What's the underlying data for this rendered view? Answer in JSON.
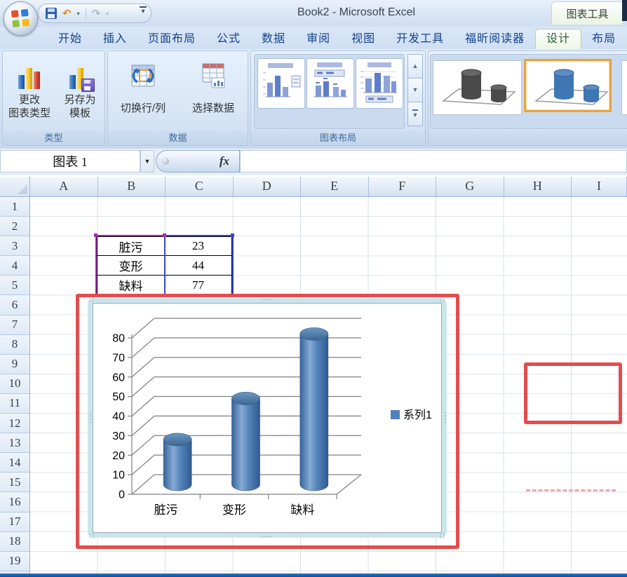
{
  "window": {
    "title": "Book2 - Microsoft Excel",
    "contextual_tool_label": "图表工具"
  },
  "tabs": {
    "items": [
      {
        "label": "开始",
        "active": false
      },
      {
        "label": "插入",
        "active": false
      },
      {
        "label": "页面布局",
        "active": false
      },
      {
        "label": "公式",
        "active": false
      },
      {
        "label": "数据",
        "active": false
      },
      {
        "label": "审阅",
        "active": false
      },
      {
        "label": "视图",
        "active": false
      },
      {
        "label": "开发工具",
        "active": false
      },
      {
        "label": "福昕阅读器",
        "active": false
      },
      {
        "label": "设计",
        "active": true
      },
      {
        "label": "布局",
        "active": false
      }
    ]
  },
  "ribbon": {
    "type_group": {
      "label": "类型",
      "change_chart_type": {
        "line1": "更改",
        "line2": "图表类型"
      },
      "save_template": {
        "line1": "另存为",
        "line2": "模板"
      }
    },
    "data_group": {
      "label": "数据",
      "switch_row_col": "切换行/列",
      "select_data": "选择数据"
    },
    "layout_group": {
      "label": "图表布局"
    }
  },
  "formula_bar": {
    "name_box": "图表 1",
    "fx_label": "fx"
  },
  "sheet": {
    "columns": [
      "A",
      "B",
      "C",
      "D",
      "E",
      "F",
      "G",
      "H",
      "I"
    ],
    "rows": [
      "1",
      "2",
      "3",
      "4",
      "5",
      "6",
      "7",
      "8",
      "9",
      "10",
      "11",
      "12",
      "13",
      "14",
      "15",
      "16",
      "17",
      "18",
      "19"
    ]
  },
  "table": {
    "rows": [
      {
        "label": "脏污",
        "value": "23"
      },
      {
        "label": "变形",
        "value": "44"
      },
      {
        "label": "缺料",
        "value": "77"
      }
    ]
  },
  "chart_data": {
    "type": "bar",
    "subtype": "cylinder-3d",
    "categories": [
      "脏污",
      "变形",
      "缺料"
    ],
    "series": [
      {
        "name": "系列1",
        "values": [
          23,
          44,
          77
        ]
      }
    ],
    "title": "",
    "xlabel": "",
    "ylabel": "",
    "ylim": [
      0,
      80
    ],
    "ytick_step": 10,
    "grid": true,
    "legend_position": "right",
    "bar_color": "#4f81bd"
  },
  "colors": {
    "annotation_red": "#e34d4d",
    "cylinder_blue": "#4f81bd",
    "selection_purple": "#a02fae",
    "selection_blue": "#3a46d0"
  }
}
